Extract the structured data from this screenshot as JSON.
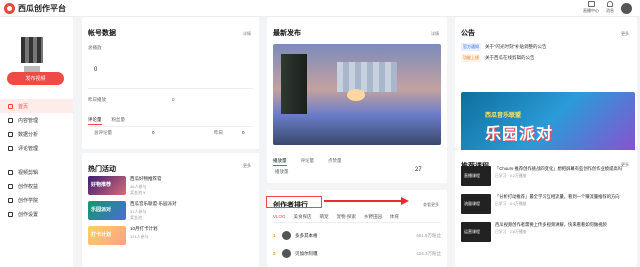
{
  "header": {
    "logo_text": "西瓜创作平台",
    "actions": [
      {
        "label": "直播中心",
        "icon": "monitor-icon"
      },
      {
        "label": "消息",
        "icon": "bell-icon"
      }
    ]
  },
  "sidebar": {
    "publish_label": "发布视频",
    "items": [
      {
        "label": "首页",
        "icon": "home-icon",
        "active": true
      },
      {
        "label": "内容管理",
        "icon": "content-icon"
      },
      {
        "label": "数据分析",
        "icon": "chart-icon"
      },
      {
        "label": "评论管理",
        "icon": "comment-icon"
      },
      {
        "label": "视频剪辑",
        "icon": "scissors-icon"
      },
      {
        "label": "创作权益",
        "icon": "gift-icon"
      },
      {
        "label": "创作学院",
        "icon": "book-icon"
      },
      {
        "label": "创作设置",
        "icon": "gear-icon"
      }
    ]
  },
  "account": {
    "title": "帐号数据",
    "detail": "详情",
    "fans_label": "总播放",
    "yesterday_label": "昨日播放",
    "value_zero": "0",
    "tabs": [
      "评论量",
      "粉丝量"
    ],
    "total_label": "总评论量",
    "yesterday_label2": "昨日",
    "yesterday_value": "0"
  },
  "hot": {
    "title": "热门活动",
    "more": "更多",
    "items": [
      {
        "thumb": "好物推荐",
        "title": "西瓜好物推荐官",
        "meta": "46人参与",
        "meta2": "奖金池 ¥"
      },
      {
        "thumb": "乐园派对",
        "title": "西瓜音乐联盟-乐园派对",
        "meta": "31人参与",
        "meta2": "奖金池"
      },
      {
        "thumb": "打卡计划",
        "title": "10月打卡计划",
        "meta": "121人参与",
        "meta2": ""
      }
    ]
  },
  "latest": {
    "title": "最新发布",
    "detail": "详情",
    "tabs": [
      "播放量",
      "评论量",
      "点赞量"
    ],
    "row_label": "播放量",
    "row_value": "27"
  },
  "creator": {
    "title": "创作者排行",
    "more": "查看更多",
    "tabs": [
      "VLOG",
      "美食探店",
      "萌宠",
      "宠物·探索",
      "乡野田园",
      "体育"
    ],
    "rows": [
      {
        "rank": "1",
        "name": "多多其本格",
        "count": "461.5万粉丝"
      },
      {
        "rank": "2",
        "name": "贝加尔阿嘎",
        "count": "424.3万粉丝"
      }
    ]
  },
  "notice": {
    "title": "公告",
    "more": "更多",
    "items": [
      {
        "tag": "官方通知",
        "text": "关于“闪光时刻”补贴调整的公告"
      },
      {
        "tag": "功能上线",
        "text": "关于西瓜在线剪辑的公告"
      }
    ],
    "banner_top": "西瓜音乐联盟",
    "banner_main": "乐园派对"
  },
  "courses": {
    "title": "推荐课程",
    "more": "更多",
    "items": [
      {
        "thumb": "直播课程",
        "title": "「Chours·推荐创作挑战四变化」想把屏幕有些创作创作业绩提高吗",
        "meta": "已学习 · 5.2万播放"
      },
      {
        "thumb": "流量课程",
        "title": "「分析打动推荐」最全学习互相流量，看到一个赚流量推荐的方向",
        "meta": "已学习 · 5.4万播放"
      },
      {
        "thumb": "运营课程",
        "title": "西瓜视频创作者需要上传多视频讲解，快来看看如何做视频",
        "meta": "已学习 · 2.8万播放"
      }
    ]
  },
  "colors": {
    "accent": "#ef4a45"
  }
}
